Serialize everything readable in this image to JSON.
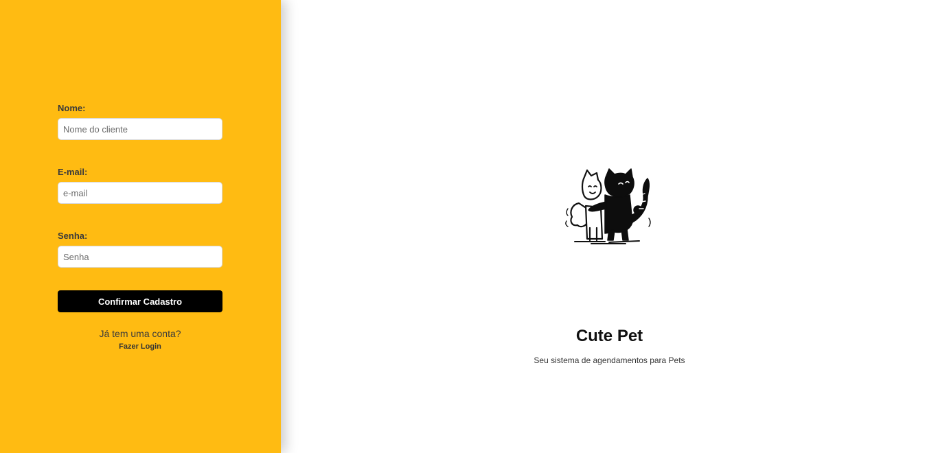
{
  "form": {
    "name_label": "Nome:",
    "name_placeholder": "Nome do cliente",
    "name_value": "",
    "email_label": "E-mail:",
    "email_placeholder": "e-mail",
    "email_value": "",
    "password_label": "Senha:",
    "password_placeholder": "Senha",
    "password_value": "",
    "submit_label": "Confirmar Cadastro"
  },
  "login": {
    "question": "Já tem uma conta?",
    "link_label": "Fazer Login"
  },
  "brand": {
    "logo_icon": "cat-and-dog-hug-icon",
    "title": "Cute Pet",
    "subtitle": "Seu sistema de agendamentos para Pets"
  },
  "colors": {
    "panel_background": "#ffbb12",
    "button_background": "#000000",
    "button_text": "#ffffff"
  }
}
